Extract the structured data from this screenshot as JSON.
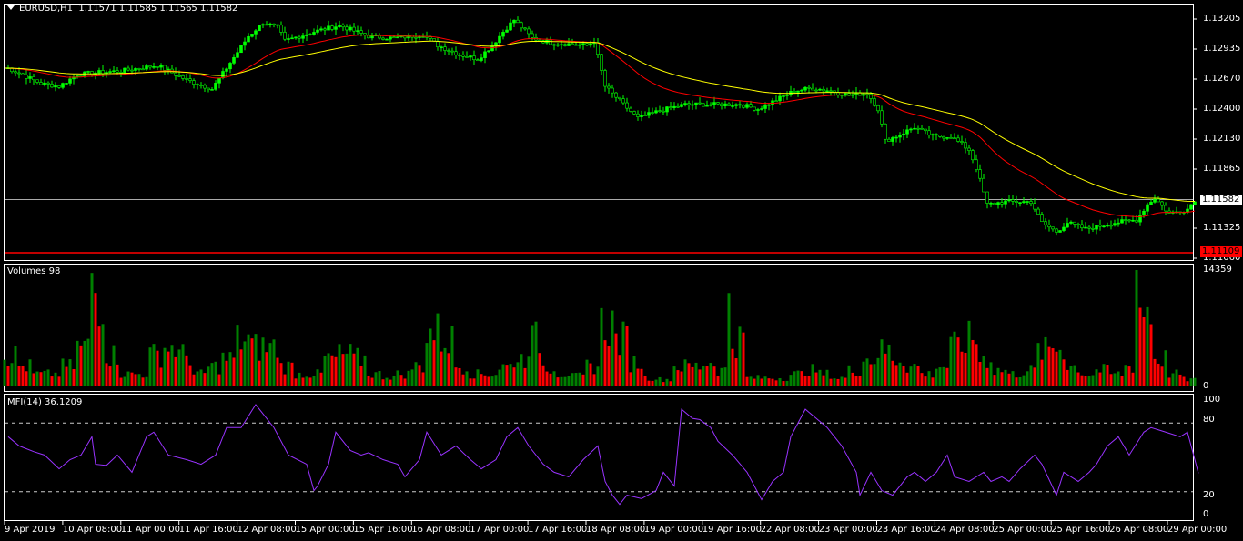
{
  "header": {
    "symbol": "EURUSD,H1",
    "ohlc": "1.11571 1.11585 1.11565 1.11582"
  },
  "price_axis": {
    "ticks": [
      "1.13205",
      "1.12935",
      "1.12670",
      "1.12400",
      "1.12130",
      "1.11865",
      "1.11325",
      "1.11060"
    ],
    "current_price": "1.11582",
    "level_price": "1.11109"
  },
  "volume_panel": {
    "label": "Volumes 98",
    "max_label": "14359",
    "zero_label": "0"
  },
  "mfi_panel": {
    "label": "MFI(14) 36.1209",
    "ticks": [
      "100",
      "80",
      "20",
      "0"
    ]
  },
  "time_axis": [
    "9 Apr 2019",
    "10 Apr 08:00",
    "11 Apr 00:00",
    "11 Apr 16:00",
    "12 Apr 08:00",
    "15 Apr 00:00",
    "15 Apr 16:00",
    "16 Apr 08:00",
    "17 Apr 00:00",
    "17 Apr 16:00",
    "18 Apr 08:00",
    "19 Apr 00:00",
    "19 Apr 16:00",
    "22 Apr 08:00",
    "23 Apr 00:00",
    "23 Apr 16:00",
    "24 Apr 08:00",
    "25 Apr 00:00",
    "25 Apr 16:00",
    "26 Apr 08:00",
    "29 Apr 00:00"
  ],
  "colors": {
    "bull": "#00ff00",
    "ma_fast": "#ff0000",
    "ma_slow": "#ffff00",
    "vol_up": "#008000",
    "vol_down": "#ff0000",
    "mfi": "#9933ff",
    "level": "#ff0000"
  },
  "chart_data": {
    "type": "candlestick",
    "price_range": [
      1.1106,
      1.1334
    ],
    "close_path": [
      [
        1,
        1.12764
      ],
      [
        10,
        1.12625
      ],
      [
        15,
        1.126
      ],
      [
        20,
        1.12707
      ],
      [
        25,
        1.12723
      ],
      [
        32,
        1.12739
      ],
      [
        42,
        1.12788
      ],
      [
        50,
        1.12658
      ],
      [
        57,
        1.12576
      ],
      [
        61,
        1.12764
      ],
      [
        67,
        1.1305
      ],
      [
        71,
        1.13172
      ],
      [
        75,
        1.13131
      ],
      [
        77,
        1.13009
      ],
      [
        85,
        1.13091
      ],
      [
        92,
        1.13148
      ],
      [
        100,
        1.1305
      ],
      [
        107,
        1.13033
      ],
      [
        115,
        1.13066
      ],
      [
        119,
        1.12968
      ],
      [
        125,
        1.12886
      ],
      [
        130,
        1.12846
      ],
      [
        134,
        1.12968
      ],
      [
        137,
        1.13091
      ],
      [
        140,
        1.13197
      ],
      [
        145,
        1.13033
      ],
      [
        150,
        1.12993
      ],
      [
        160,
        1.12968
      ],
      [
        162,
        1.13009
      ],
      [
        165,
        1.126
      ],
      [
        170,
        1.12437
      ],
      [
        174,
        1.12314
      ],
      [
        180,
        1.1238
      ],
      [
        187,
        1.12437
      ],
      [
        195,
        1.12437
      ],
      [
        202,
        1.12437
      ],
      [
        207,
        1.12396
      ],
      [
        212,
        1.12478
      ],
      [
        217,
        1.1256
      ],
      [
        222,
        1.12584
      ],
      [
        227,
        1.1256
      ],
      [
        232,
        1.12519
      ],
      [
        237,
        1.12543
      ],
      [
        240,
        1.12396
      ],
      [
        242,
        1.1211
      ],
      [
        245,
        1.12151
      ],
      [
        250,
        1.12233
      ],
      [
        255,
        1.12151
      ],
      [
        260,
        1.12151
      ],
      [
        265,
        1.12029
      ],
      [
        267,
        1.11865
      ],
      [
        270,
        1.11538
      ],
      [
        275,
        1.11563
      ],
      [
        282,
        1.11563
      ],
      [
        285,
        1.11375
      ],
      [
        289,
        1.11293
      ],
      [
        292,
        1.11375
      ],
      [
        297,
        1.11318
      ],
      [
        305,
        1.11375
      ],
      [
        311,
        1.11399
      ],
      [
        314,
        1.11538
      ],
      [
        316,
        1.11596
      ],
      [
        320,
        1.11457
      ],
      [
        325,
        1.11497
      ],
      [
        327,
        1.11582
      ]
    ],
    "volume_4h": [
      4000,
      2500,
      1500,
      1500,
      2500,
      5000,
      12000,
      4000,
      1500,
      1500,
      4000,
      5000,
      4000,
      1500,
      2500,
      3500,
      6000,
      5000,
      5000,
      2500,
      1500,
      1500,
      3500,
      4000,
      3500,
      1500,
      1200,
      1500,
      2500,
      7000,
      6000,
      2500,
      1500,
      1500,
      2500,
      3500,
      6000,
      2500,
      1500,
      1200,
      2500,
      8000,
      6000,
      3000,
      1000,
      800,
      2500,
      2500,
      3000,
      2000,
      6000,
      1000,
      1000,
      1000,
      1500,
      2000,
      1500,
      1000,
      2000,
      3500,
      4500,
      3500,
      2500,
      1500,
      2500,
      5000,
      6000,
      3500,
      2000,
      1500,
      2000,
      4500,
      5000,
      2500,
      1500,
      2000,
      1500,
      2500,
      10000,
      3500,
      1500,
      800
    ],
    "volume_max": 14359,
    "mfi": [
      [
        1,
        68
      ],
      [
        4,
        60
      ],
      [
        8,
        55
      ],
      [
        11,
        52
      ],
      [
        15,
        40
      ],
      [
        18,
        48
      ],
      [
        21,
        52
      ],
      [
        24,
        68
      ],
      [
        25,
        44
      ],
      [
        28,
        43
      ],
      [
        31,
        52
      ],
      [
        35,
        37
      ],
      [
        39,
        68
      ],
      [
        41,
        72
      ],
      [
        45,
        52
      ],
      [
        50,
        48
      ],
      [
        54,
        44
      ],
      [
        58,
        52
      ],
      [
        61,
        76
      ],
      [
        65,
        76
      ],
      [
        69,
        96
      ],
      [
        71,
        88
      ],
      [
        74,
        76
      ],
      [
        78,
        52
      ],
      [
        83,
        44
      ],
      [
        85,
        21
      ],
      [
        86,
        25
      ],
      [
        89,
        44
      ],
      [
        91,
        72
      ],
      [
        95,
        56
      ],
      [
        98,
        52
      ],
      [
        100,
        54
      ],
      [
        104,
        48
      ],
      [
        108,
        44
      ],
      [
        110,
        33
      ],
      [
        114,
        48
      ],
      [
        116,
        72
      ],
      [
        120,
        52
      ],
      [
        124,
        60
      ],
      [
        128,
        48
      ],
      [
        131,
        40
      ],
      [
        135,
        48
      ],
      [
        138,
        68
      ],
      [
        141,
        76
      ],
      [
        144,
        60
      ],
      [
        148,
        44
      ],
      [
        151,
        37
      ],
      [
        155,
        33
      ],
      [
        159,
        48
      ],
      [
        163,
        60
      ],
      [
        165,
        29
      ],
      [
        167,
        17
      ],
      [
        169,
        9
      ],
      [
        171,
        17
      ],
      [
        175,
        14
      ],
      [
        179,
        21
      ],
      [
        181,
        37
      ],
      [
        184,
        25
      ],
      [
        186,
        92
      ],
      [
        189,
        84
      ],
      [
        191,
        83
      ],
      [
        194,
        76
      ],
      [
        196,
        64
      ],
      [
        200,
        52
      ],
      [
        204,
        37
      ],
      [
        208,
        13
      ],
      [
        211,
        29
      ],
      [
        214,
        37
      ],
      [
        216,
        68
      ],
      [
        220,
        92
      ],
      [
        223,
        84
      ],
      [
        226,
        76
      ],
      [
        230,
        60
      ],
      [
        234,
        37
      ],
      [
        235,
        17
      ],
      [
        238,
        37
      ],
      [
        241,
        21
      ],
      [
        244,
        17
      ],
      [
        248,
        33
      ],
      [
        250,
        37
      ],
      [
        253,
        29
      ],
      [
        256,
        37
      ],
      [
        259,
        52
      ],
      [
        261,
        33
      ],
      [
        265,
        29
      ],
      [
        269,
        37
      ],
      [
        271,
        29
      ],
      [
        274,
        33
      ],
      [
        276,
        29
      ],
      [
        279,
        40
      ],
      [
        283,
        52
      ],
      [
        285,
        44
      ],
      [
        289,
        17
      ],
      [
        291,
        37
      ],
      [
        295,
        29
      ],
      [
        298,
        37
      ],
      [
        300,
        44
      ],
      [
        303,
        60
      ],
      [
        306,
        68
      ],
      [
        309,
        52
      ],
      [
        313,
        72
      ],
      [
        315,
        76
      ],
      [
        319,
        72
      ],
      [
        323,
        68
      ],
      [
        325,
        72
      ],
      [
        328,
        36.12
      ]
    ],
    "mfi_levels": [
      80,
      20
    ]
  }
}
